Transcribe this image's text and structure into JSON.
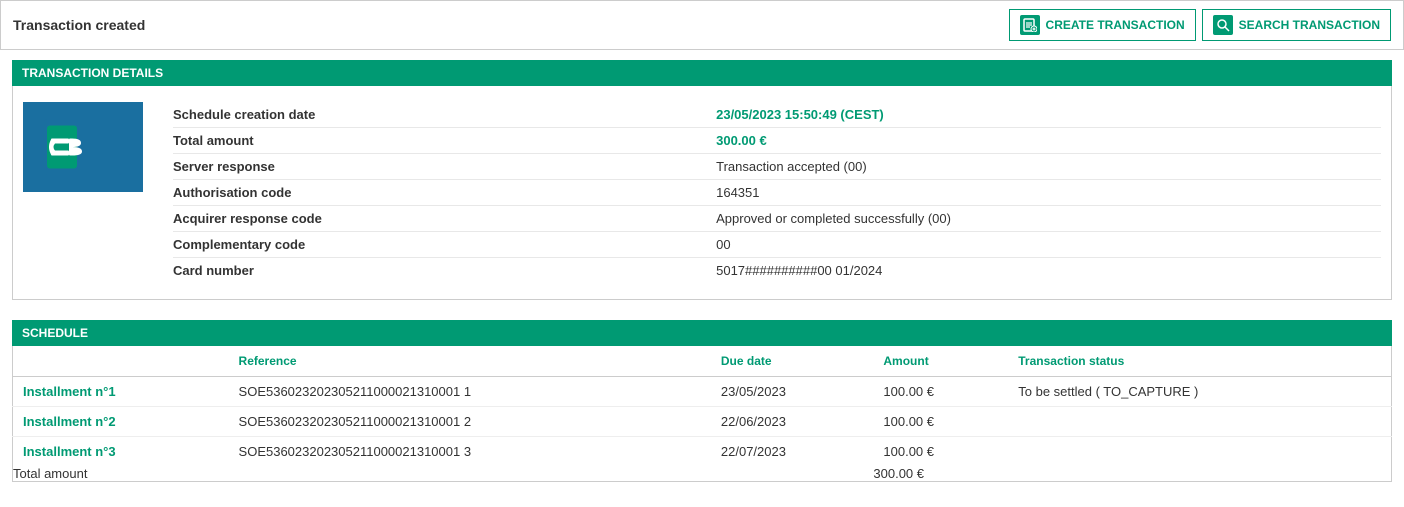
{
  "header": {
    "title": "Transaction created",
    "buttons": [
      {
        "id": "create-transaction",
        "label": "CREATE TRANSACTION",
        "icon": "📄"
      },
      {
        "id": "search-transaction",
        "label": "SEARCH TRANSACTION",
        "icon": "🔍"
      }
    ]
  },
  "transaction_details": {
    "section_title": "TRANSACTION DETAILS",
    "fields": [
      {
        "label": "Schedule creation date",
        "value": "23/05/2023 15:50:49 (CEST)",
        "green": true
      },
      {
        "label": "Total amount",
        "value": "300.00 €",
        "green": true
      },
      {
        "label": "Server response",
        "value": "Transaction accepted (00)",
        "green": false
      },
      {
        "label": "Authorisation code",
        "value": "164351",
        "green": false
      },
      {
        "label": "Acquirer response code",
        "value": "Approved or completed successfully (00)",
        "green": false
      },
      {
        "label": "Complementary code",
        "value": "00",
        "green": false
      },
      {
        "label": "Card number",
        "value": "5017##########00  01/2024",
        "green": false
      }
    ]
  },
  "schedule": {
    "section_title": "SCHEDULE",
    "columns": [
      "",
      "Reference",
      "Due date",
      "Amount",
      "Transaction status"
    ],
    "rows": [
      {
        "installment": "Installment n°1",
        "reference": "SOE536023202305211000021310001 1",
        "due_date": "23/05/2023",
        "amount": "100.00 €",
        "status": "To be settled ( TO_CAPTURE )"
      },
      {
        "installment": "Installment n°2",
        "reference": "SOE536023202305211000021310001 2",
        "due_date": "22/06/2023",
        "amount": "100.00 €",
        "status": ""
      },
      {
        "installment": "Installment n°3",
        "reference": "SOE536023202305211000021310001 3",
        "due_date": "22/07/2023",
        "amount": "100.00 €",
        "status": ""
      }
    ],
    "total_label": "Total amount",
    "total_amount": "300.00 €"
  }
}
